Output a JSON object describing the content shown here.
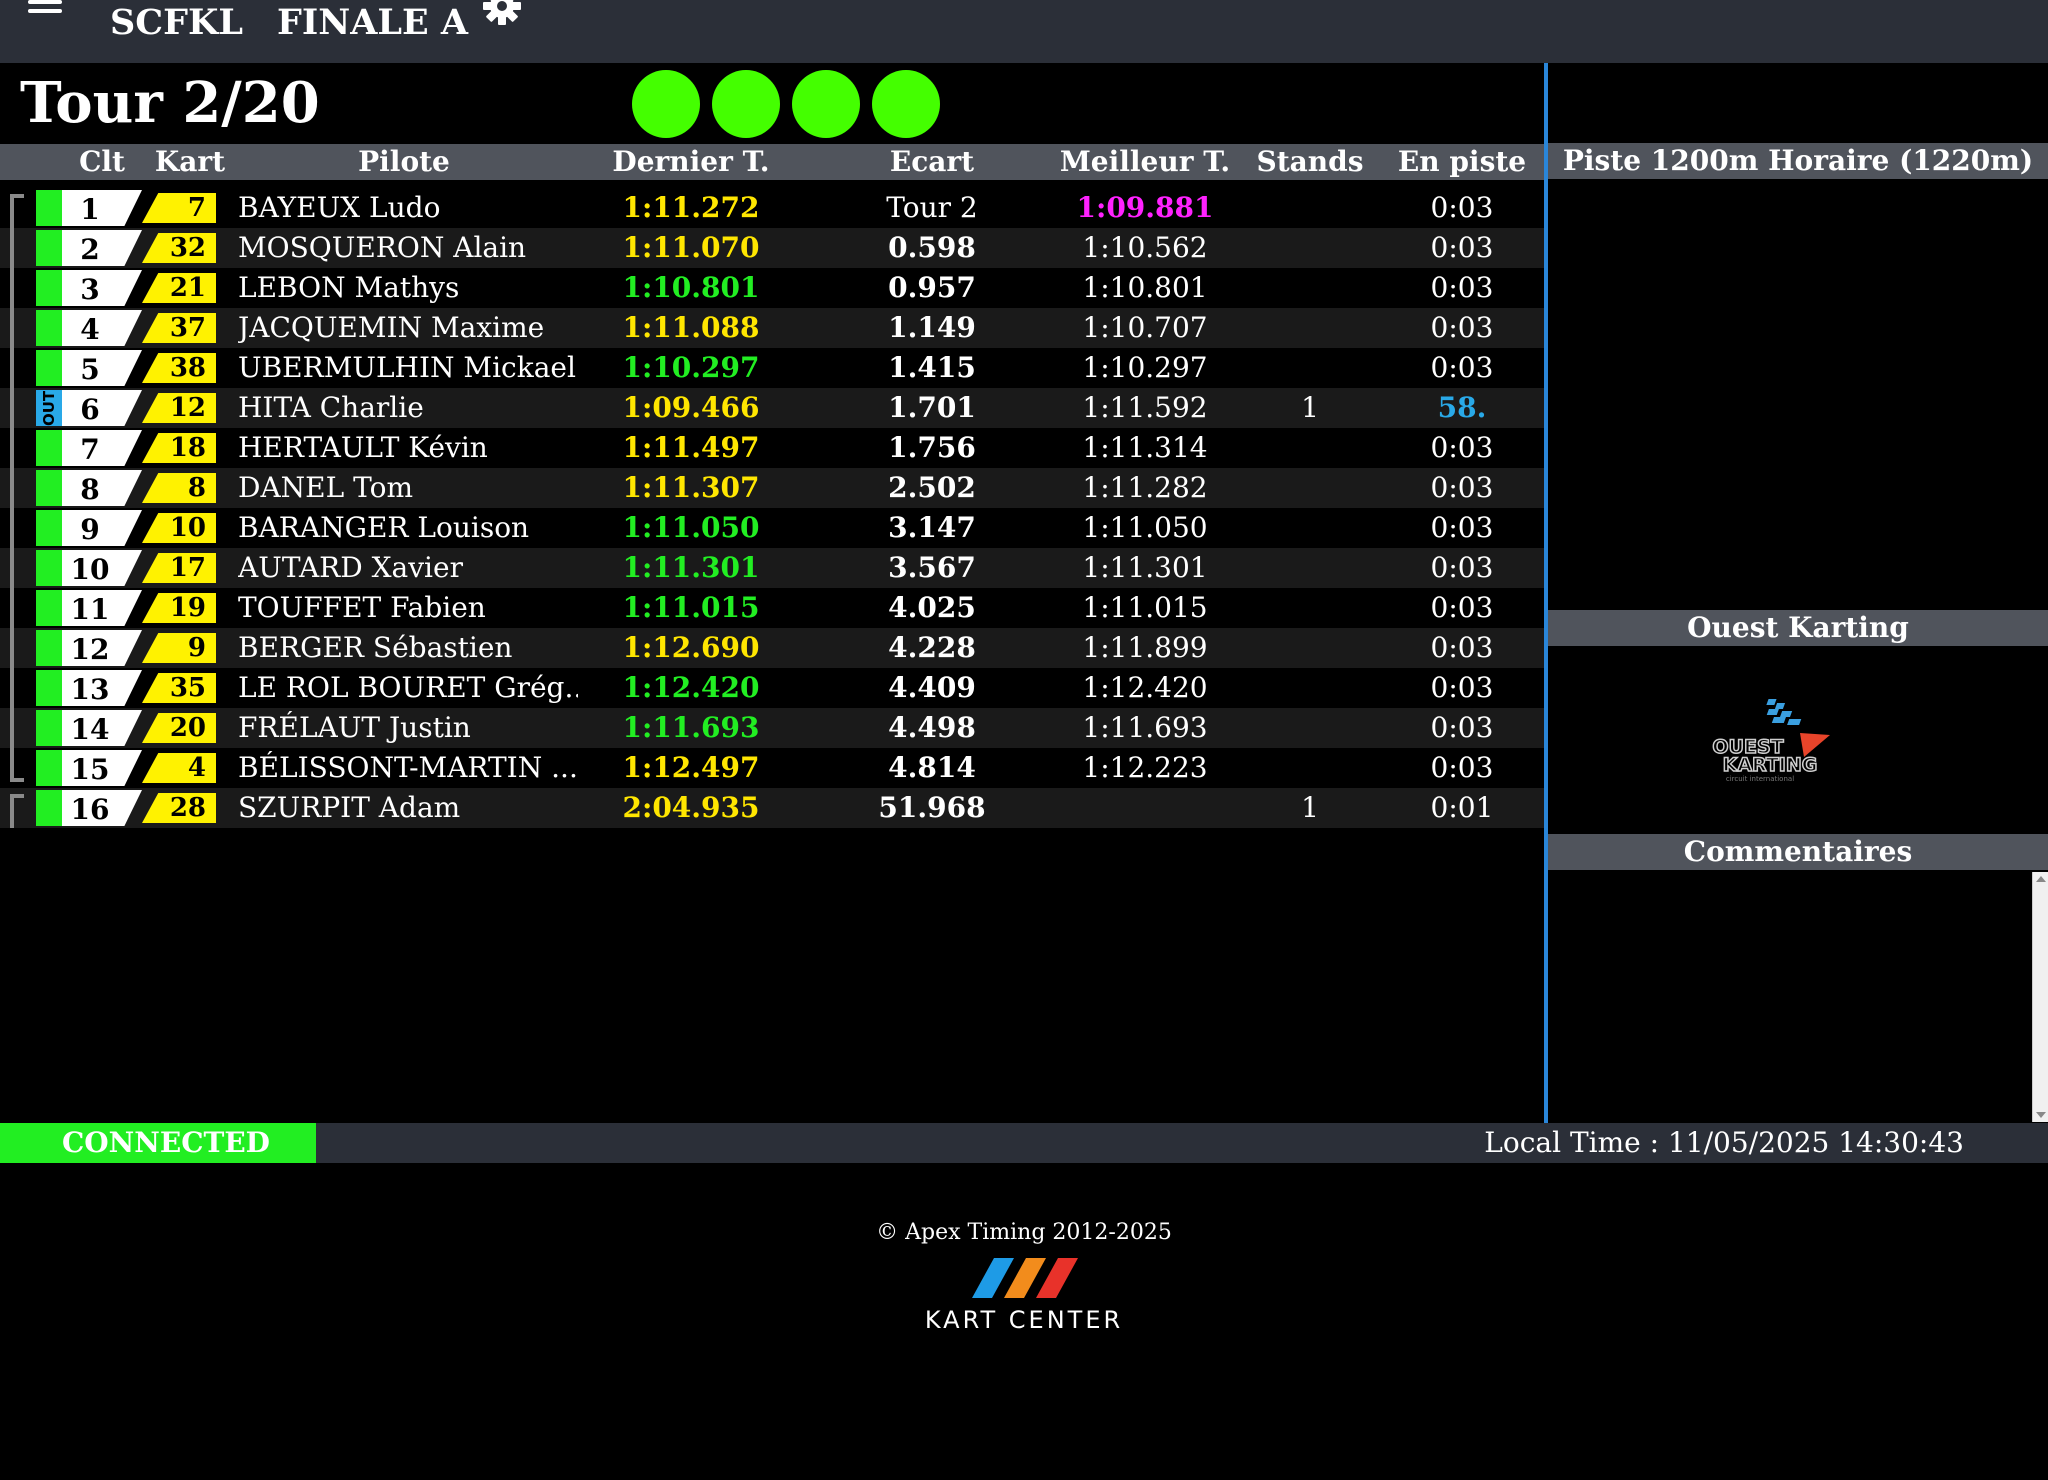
{
  "header": {
    "track": "SCFKL",
    "session": "FINALE A"
  },
  "lap_counter": "Tour 2/20",
  "columns": {
    "clt": "Clt",
    "kart": "Kart",
    "pilote": "Pilote",
    "dernier": "Dernier T.",
    "ecart": "Ecart",
    "meilleur": "Meilleur T.",
    "stands": "Stands",
    "en_piste": "En piste"
  },
  "rows": [
    {
      "pos": "1",
      "kart": "7",
      "name": "BAYEUX Ludo",
      "last": "1:11.272",
      "gap": "Tour 2",
      "best": "1:09.881",
      "stands": "",
      "track": "0:03"
    },
    {
      "pos": "2",
      "kart": "32",
      "name": "MOSQUERON Alain",
      "last": "1:11.070",
      "gap": "0.598",
      "best": "1:10.562",
      "stands": "",
      "track": "0:03"
    },
    {
      "pos": "3",
      "kart": "21",
      "name": "LEBON Mathys",
      "last": "1:10.801",
      "gap": "0.957",
      "best": "1:10.801",
      "stands": "",
      "track": "0:03"
    },
    {
      "pos": "4",
      "kart": "37",
      "name": "JACQUEMIN Maxime",
      "last": "1:11.088",
      "gap": "1.149",
      "best": "1:10.707",
      "stands": "",
      "track": "0:03"
    },
    {
      "pos": "5",
      "kart": "38",
      "name": "UBERMULHIN Mickael",
      "last": "1:10.297",
      "gap": "1.415",
      "best": "1:10.297",
      "stands": "",
      "track": "0:03"
    },
    {
      "pos": "6",
      "kart": "12",
      "name": "HITA Charlie",
      "last": "1:09.466",
      "gap": "1.701",
      "best": "1:11.592",
      "stands": "1",
      "track": "58.",
      "status": "OUT"
    },
    {
      "pos": "7",
      "kart": "18",
      "name": "HERTAULT Kévin",
      "last": "1:11.497",
      "gap": "1.756",
      "best": "1:11.314",
      "stands": "",
      "track": "0:03"
    },
    {
      "pos": "8",
      "kart": "8",
      "name": "DANEL Tom",
      "last": "1:11.307",
      "gap": "2.502",
      "best": "1:11.282",
      "stands": "",
      "track": "0:03"
    },
    {
      "pos": "9",
      "kart": "10",
      "name": "BARANGER Louison",
      "last": "1:11.050",
      "gap": "3.147",
      "best": "1:11.050",
      "stands": "",
      "track": "0:03"
    },
    {
      "pos": "10",
      "kart": "17",
      "name": "AUTARD Xavier",
      "last": "1:11.301",
      "gap": "3.567",
      "best": "1:11.301",
      "stands": "",
      "track": "0:03"
    },
    {
      "pos": "11",
      "kart": "19",
      "name": "TOUFFET Fabien",
      "last": "1:11.015",
      "gap": "4.025",
      "best": "1:11.015",
      "stands": "",
      "track": "0:03"
    },
    {
      "pos": "12",
      "kart": "9",
      "name": "BERGER Sébastien",
      "last": "1:12.690",
      "gap": "4.228",
      "best": "1:11.899",
      "stands": "",
      "track": "0:03"
    },
    {
      "pos": "13",
      "kart": "35",
      "name": "LE ROL BOURET Grég...",
      "last": "1:12.420",
      "gap": "4.409",
      "best": "1:12.420",
      "stands": "",
      "track": "0:03"
    },
    {
      "pos": "14",
      "kart": "20",
      "name": "FRÉLAUT Justin",
      "last": "1:11.693",
      "gap": "4.498",
      "best": "1:11.693",
      "stands": "",
      "track": "0:03"
    },
    {
      "pos": "15",
      "kart": "4",
      "name": "BÉLISSONT-MARTIN ...",
      "last": "1:12.497",
      "gap": "4.814",
      "best": "1:12.223",
      "stands": "",
      "track": "0:03"
    },
    {
      "pos": "16",
      "kart": "28",
      "name": "SZURPIT Adam",
      "last": "2:04.935",
      "gap": "51.968",
      "best": "",
      "stands": "1",
      "track": "0:01"
    }
  ],
  "side": {
    "track_title": "Piste 1200m Horaire (1220m)",
    "sponsor_title": "Ouest Karting",
    "comments_title": "Commentaires",
    "logo_text": {
      "line1": "OUEST",
      "line2": "KARTING",
      "line3": "circuit international"
    }
  },
  "footer": {
    "status": "CONNECTED",
    "local_time": "Local Time : 11/05/2025 14:30:43",
    "copyright": "© Apex Timing 2012-2025",
    "brand": "KART CENTER"
  },
  "colors": {
    "green_light": "#44ff00",
    "personal_best": "#22ee22",
    "lap_yellow": "#ffe600",
    "overall_best": "#ff22ff",
    "pit_blue": "#29a9e8"
  }
}
